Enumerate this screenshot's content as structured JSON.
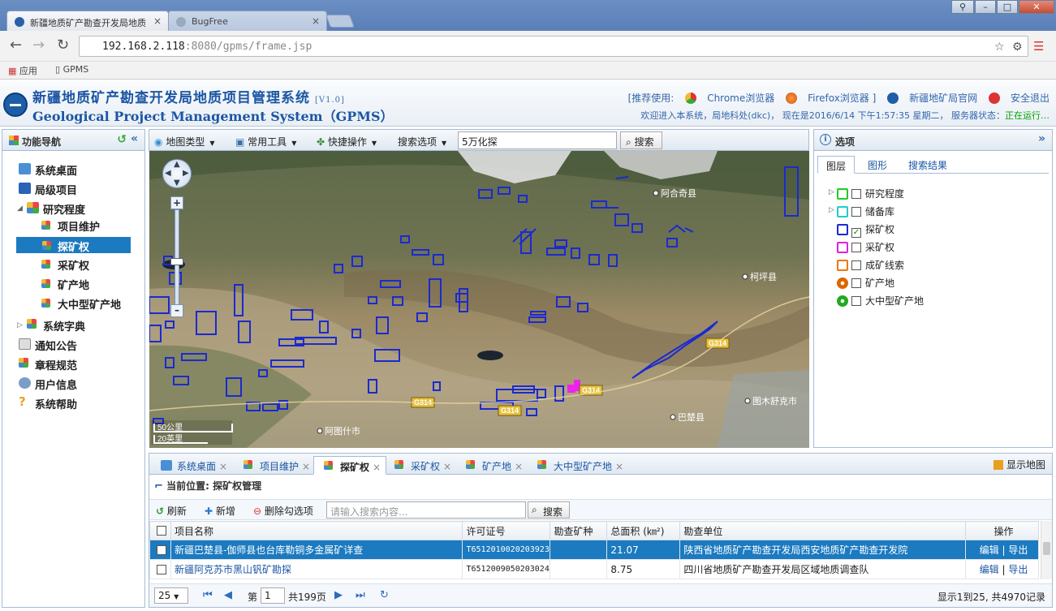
{
  "browser": {
    "tabs": [
      {
        "label": "新疆地质矿产勘查开发局地质"
      },
      {
        "label": "BugFree"
      }
    ],
    "url_host": "192.168.2.118",
    "url_rest": ":8080/gpms/frame.jsp",
    "bookmarks": {
      "apps": "应用",
      "gpms": "GPMS"
    }
  },
  "header": {
    "title_cn": "新疆地质矿产勘查开发局地质项目管理系统",
    "version": "[V1.0]",
    "title_en": "Geological Project Management System（GPMS）",
    "recommend": "[推荐使用:",
    "chrome": "Chrome浏览器",
    "firefox": "Firefox浏览器 ]",
    "official": "新疆地矿局官网",
    "logout": "安全退出",
    "welcome": "欢迎进入本系统，局地科处(dkc)， 现在是2016/6/14 下午1:57:35 星期二， 服务器状态：",
    "server_status": "正在运行…"
  },
  "sidebar": {
    "title": "功能导航",
    "items": [
      {
        "label": "系统桌面"
      },
      {
        "label": "局级项目"
      },
      {
        "label": "研究程度"
      },
      {
        "label": "项目维护"
      },
      {
        "label": "探矿权"
      },
      {
        "label": "采矿权"
      },
      {
        "label": "矿产地"
      },
      {
        "label": "大中型矿产地"
      },
      {
        "label": "系统字典"
      },
      {
        "label": "通知公告"
      },
      {
        "label": "章程规范"
      },
      {
        "label": "用户信息"
      },
      {
        "label": "系统帮助"
      }
    ]
  },
  "toolbar": {
    "map_type": "地图类型",
    "tools": "常用工具",
    "quick": "快捷操作",
    "search_opt": "搜索选项",
    "search_value": "5万化探",
    "search_btn": "搜索"
  },
  "map": {
    "places": [
      "阿合奇县",
      "柯坪县",
      "图木舒克市",
      "巴楚县",
      "阿图什市"
    ],
    "roads": [
      "G314",
      "G314",
      "G314",
      "G314"
    ],
    "scale": [
      "50公里",
      "20英里"
    ]
  },
  "right_panel": {
    "title": "选项",
    "tabs": [
      "图层",
      "图形",
      "搜索结果"
    ],
    "layers": [
      {
        "label": "研究程度",
        "color": "#22cc22",
        "checked": false
      },
      {
        "label": "储备库",
        "color": "#22cccc",
        "checked": false
      },
      {
        "label": "探矿权",
        "color": "#1a2ad0",
        "checked": true
      },
      {
        "label": "采矿权",
        "color": "#dd22dd",
        "checked": false
      },
      {
        "label": "成矿线索",
        "color": "#ee7711",
        "checked": false
      },
      {
        "label": "矿产地",
        "color": "#dd6600",
        "checked": false
      },
      {
        "label": "大中型矿产地",
        "color": "#22aa22",
        "checked": false
      }
    ]
  },
  "bottom": {
    "tabs": [
      "系统桌面",
      "项目维护",
      "探矿权",
      "采矿权",
      "矿产地",
      "大中型矿产地"
    ],
    "show_map": "显示地图",
    "crumb": "当前位置: 探矿权管理",
    "refresh": "刷新",
    "add": "新增",
    "delete": "删除勾选项",
    "search_placeholder": "请输入搜索内容...",
    "search_btn": "搜索",
    "columns": [
      "项目名称",
      "许可证号",
      "勘查矿种",
      "总面积 (㎞²)",
      "勘查单位",
      "操作"
    ],
    "rows": [
      {
        "name": "新疆巴楚县-伽师县也台库勒铜多金属矿详查",
        "license": "T65120100202039​23",
        "mineral": "",
        "area": "21.07",
        "unit": "陕西省地质矿产勘查开发局西安地质矿产勘查开发院",
        "edit": "编辑",
        "export": "导出"
      },
      {
        "name": "新疆阿克苏市黑山钒矿勘探",
        "license": "T65120090502030​24",
        "mineral": "",
        "area": "8.75",
        "unit": "四川省地质矿产勘查开发局区域地质调查队",
        "edit": "编辑",
        "export": "导出"
      }
    ],
    "pager": {
      "page_size": "25",
      "page_prefix": "第",
      "page": "1",
      "page_total": "共199页",
      "summary": "显示1到25, 共4970记录"
    }
  },
  "colors": {
    "accent": "#1b7ac0",
    "title": "#1c56a3",
    "claims": "#1a2ad0"
  }
}
